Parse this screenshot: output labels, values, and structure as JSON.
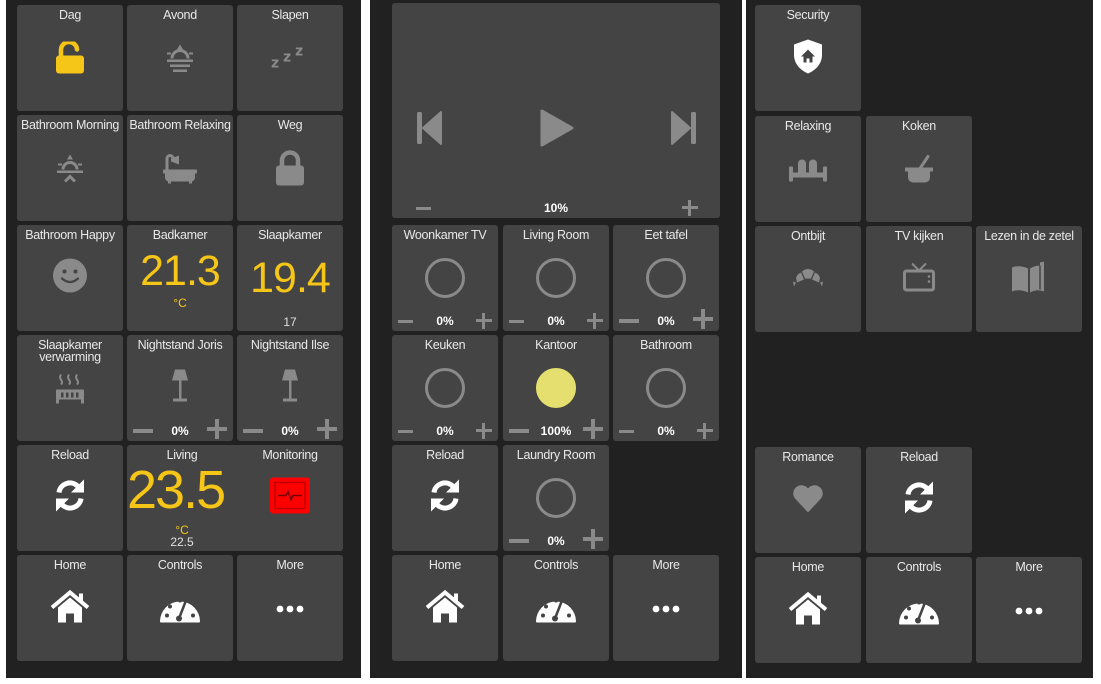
{
  "colors": {
    "panel_bg": "#212121",
    "tile_bg": "#444444",
    "accent_yellow": "#f5c518",
    "icon_grey": "#8a8a8a",
    "light_on": "#e4df6e",
    "alert_red": "#ff0000"
  },
  "panels": [
    {
      "name": "scenes-and-sensors",
      "tiles": [
        {
          "label": "Dag",
          "icon": "lock-open-icon",
          "state": "active"
        },
        {
          "label": "Avond",
          "icon": "sunset-icon"
        },
        {
          "label": "Slapen",
          "icon": "sleep-zzz-icon"
        },
        {
          "label": "Bathroom Morning",
          "icon": "sunrise-icon"
        },
        {
          "label": "Bathroom Relaxing",
          "icon": "bathtub-icon"
        },
        {
          "label": "Weg",
          "icon": "lock-closed-icon"
        },
        {
          "label": "Bathroom Happy",
          "icon": "smiley-icon"
        },
        {
          "label": "Badkamer",
          "value": "21.3",
          "unit": "°C"
        },
        {
          "label": "Slaapkamer",
          "value": "19.4",
          "sub": "17"
        },
        {
          "label": "Slaapkamer verwarming",
          "icon": "radiator-icon"
        },
        {
          "label": "Nightstand Joris",
          "icon": "lamp-icon",
          "level": "0%"
        },
        {
          "label": "Nightstand Ilse",
          "icon": "lamp-icon",
          "level": "0%"
        },
        {
          "label": "Reload",
          "icon": "refresh-icon"
        },
        {
          "label": "Living",
          "value": "23.5",
          "unit": "°C",
          "sub": "22.5"
        },
        {
          "label": "Monitoring",
          "icon": "monitor-heartbeat-icon",
          "state": "alert"
        },
        {
          "label": "Home",
          "icon": "home-icon"
        },
        {
          "label": "Controls",
          "icon": "gauge-icon"
        },
        {
          "label": "More",
          "icon": "more-dots-icon"
        }
      ]
    },
    {
      "name": "lights-and-media",
      "media": {
        "volume": "10%",
        "prev_icon": "skip-previous-icon",
        "play_icon": "play-icon",
        "next_icon": "skip-next-icon"
      },
      "tiles": [
        {
          "label": "Woonkamer TV",
          "level": "0%",
          "on": false
        },
        {
          "label": "Living Room",
          "level": "0%",
          "on": false
        },
        {
          "label": "Eet tafel",
          "level": "0%",
          "on": false
        },
        {
          "label": "Keuken",
          "level": "0%",
          "on": false
        },
        {
          "label": "Kantoor",
          "level": "100%",
          "on": true
        },
        {
          "label": "Bathroom",
          "level": "0%",
          "on": false
        },
        {
          "label": "Reload",
          "icon": "refresh-icon"
        },
        {
          "label": "Laundry Room",
          "level": "0%",
          "on": false
        },
        {
          "label": "Home",
          "icon": "home-icon"
        },
        {
          "label": "Controls",
          "icon": "gauge-icon"
        },
        {
          "label": "More",
          "icon": "more-dots-icon"
        }
      ]
    },
    {
      "name": "scenes-more",
      "tiles": [
        {
          "label": "Security",
          "icon": "shield-home-icon"
        },
        {
          "label": "Relaxing",
          "icon": "sofa-icon"
        },
        {
          "label": "Koken",
          "icon": "cooking-pot-icon"
        },
        {
          "label": "Ontbijt",
          "icon": "croissant-icon"
        },
        {
          "label": "TV kijken",
          "icon": "tv-icon"
        },
        {
          "label": "Lezen in de zetel",
          "icon": "book-icon"
        },
        {
          "label": "Romance",
          "icon": "heart-icon"
        },
        {
          "label": "Reload",
          "icon": "refresh-icon"
        },
        {
          "label": "Home",
          "icon": "home-icon"
        },
        {
          "label": "Controls",
          "icon": "gauge-icon"
        },
        {
          "label": "More",
          "icon": "more-dots-icon"
        }
      ]
    }
  ]
}
